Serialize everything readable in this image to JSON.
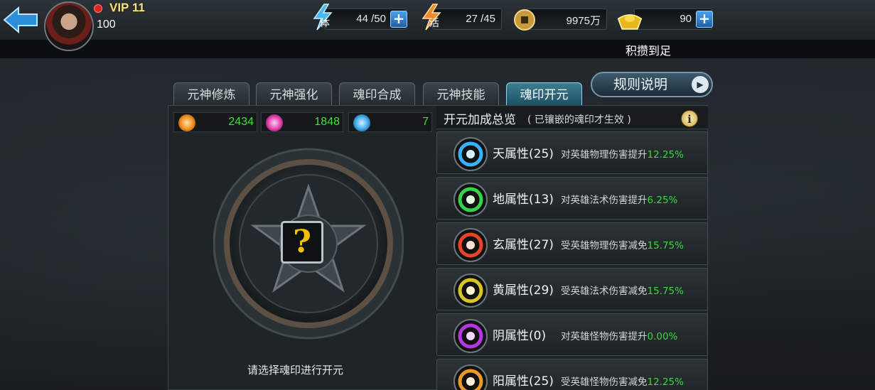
{
  "header": {
    "vip_label": "VIP 11",
    "player_level": "100",
    "stamina": {
      "icon_char": "体",
      "value": "44 /50"
    },
    "energy": {
      "icon_char": "活",
      "value": "27 /45"
    },
    "coins": {
      "value": "9975万"
    },
    "ingots": {
      "value": "90"
    },
    "hint": "积攒到足"
  },
  "tabs": [
    {
      "label": "元神修炼",
      "active": false
    },
    {
      "label": "元神强化",
      "active": false
    },
    {
      "label": "魂印合成",
      "active": false
    },
    {
      "label": "元神技能",
      "active": false
    },
    {
      "label": "魂印开元",
      "active": true
    }
  ],
  "rules_button": {
    "label": "规则说明"
  },
  "counters": [
    {
      "icon": "orange-orb-icon",
      "color": "#f08a1c",
      "value": "2434"
    },
    {
      "icon": "pink-orb-icon",
      "color": "#e03aa8",
      "value": "1848"
    },
    {
      "icon": "blue-orb-icon",
      "color": "#3aa6e6",
      "value": "7"
    }
  ],
  "seal": {
    "center_symbol": "?",
    "prompt": "请选择魂印进行开元"
  },
  "overview": {
    "title": "开元加成总览",
    "note": "( 已镶嵌的魂印才生效 )",
    "info_symbol": "i",
    "rows": [
      {
        "name": "天属性(25)",
        "desc": "对英雄物理伤害提升",
        "pct": "12.25%",
        "color": "#3ab0ff"
      },
      {
        "name": "地属性(13)",
        "desc": "对英雄法术伤害提升",
        "pct": "6.25%",
        "color": "#35d24a"
      },
      {
        "name": "玄属性(27)",
        "desc": "受英雄物理伤害减免",
        "pct": "15.75%",
        "color": "#e8442a"
      },
      {
        "name": "黄属性(29)",
        "desc": "受英雄法术伤害减免",
        "pct": "15.75%",
        "color": "#d8c52a"
      },
      {
        "name": "阴属性(0)",
        "desc": "对英雄怪物伤害提升",
        "pct": "0.00%",
        "color": "#b03ae0"
      },
      {
        "name": "阳属性(25)",
        "desc": "受英雄怪物伤害减免",
        "pct": "12.25%",
        "color": "#e89a2a"
      }
    ]
  }
}
